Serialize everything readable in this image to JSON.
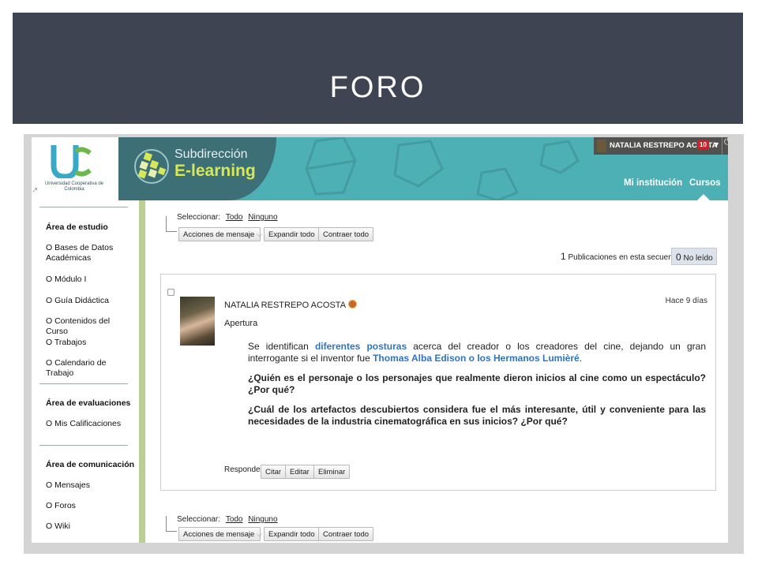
{
  "slide": {
    "title": "FORO"
  },
  "header": {
    "university_text": "Universidad Cooperativa de Colombia",
    "brand_sub": "Subdirección",
    "brand_main": "E-learning",
    "user_name": "NATALIA RESTREPO ACOSTA",
    "notification_count": "10",
    "nav": {
      "institution": "Mi institución",
      "courses": "Cursos"
    },
    "colors": {
      "teal": "#4db0b5",
      "dark_teal": "#3d6f76",
      "lime": "#d6e85a"
    }
  },
  "sidebar": {
    "sections": [
      {
        "title": "Área de estudio",
        "items": [
          "O Bases de Datos Académicas",
          "O Módulo I",
          "O Guía Didáctica",
          "O Contenidos del Curso",
          "O Trabajos",
          "O Calendario de Trabajo"
        ]
      },
      {
        "title": "Área de evaluaciones",
        "items": [
          "O Mis Calificaciones"
        ]
      },
      {
        "title": "Área de comunicación",
        "items": [
          "O Mensajes",
          "O Foros",
          "O Wiki"
        ]
      }
    ]
  },
  "toolbar": {
    "select_label": "Seleccionar:",
    "select_all": "Todo",
    "select_none": "Ninguno",
    "actions": "Acciones de mensaje",
    "expand": "Expandir todo",
    "collapse": "Contraer todo"
  },
  "thread": {
    "count": "1",
    "count_label": "Publicaciones en esta secuencia",
    "unread_count": "0",
    "unread_label": "No leído"
  },
  "post": {
    "author": "NATALIA RESTREPO ACOSTA",
    "subject": "Apertura",
    "time": "Hace 9 días",
    "p1_a": "Se identifican ",
    "p1_b": "diferentes posturas",
    "p1_c": " acerca del creador o los creadores del cine, dejando un gran interrogante si el inventor fue ",
    "p1_d": "Thomas Alba Edison o los Hermanos Lumièré",
    "p1_e": ".",
    "q1": "¿Quién es el personaje o los personajes que realmente dieron inicios al cine como un espectáculo? ¿Por qué?",
    "q2": "¿Cuál de los artefactos descubiertos considera fue el más interesante, útil y conveniente para las necesidades de la industria cinematográfica en sus inicios?  ¿Por qué?",
    "actions": {
      "reply": "Responder",
      "quote": "Citar",
      "edit": "Editar",
      "delete": "Eliminar"
    }
  }
}
